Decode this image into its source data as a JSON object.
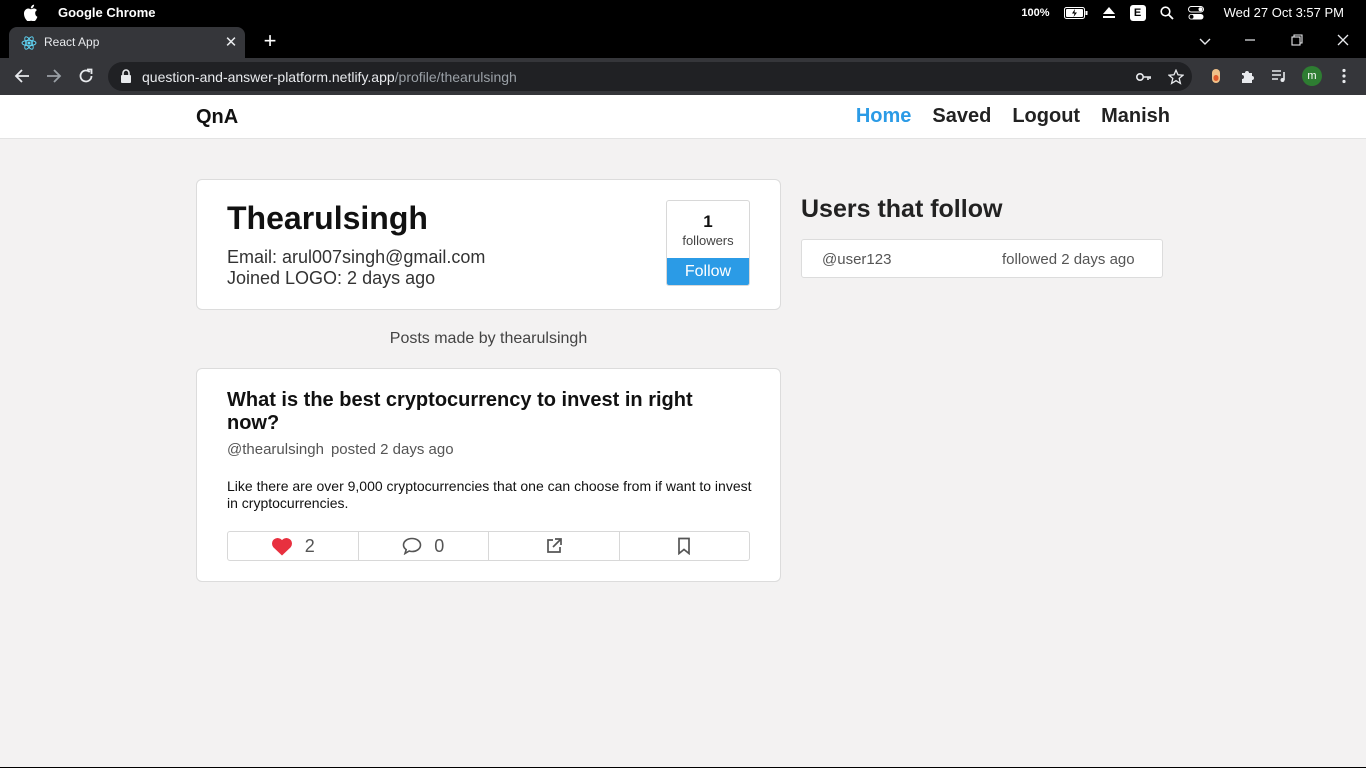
{
  "os_menubar": {
    "app_name": "Google Chrome",
    "battery_percent": "100%",
    "input_badge": "E",
    "clock": "Wed 27 Oct  3:57 PM"
  },
  "browser": {
    "tab_title": "React App",
    "url_host": "question-and-answer-platform.netlify.app",
    "url_path": "/profile/thearulsingh",
    "profile_initial": "m"
  },
  "navbar": {
    "brand": "QnA",
    "links": [
      "Home",
      "Saved",
      "Logout",
      "Manish"
    ],
    "active_link": "Home"
  },
  "profile": {
    "name": "Thearulsingh",
    "email_line": "Email: arul007singh@gmail.com",
    "joined_line": "Joined LOGO: 2 days ago",
    "followers_count": "1",
    "followers_label": "followers",
    "follow_button": "Follow"
  },
  "posts_heading": "Posts made by thearulsingh",
  "post": {
    "title": "What is the best cryptocurrency to invest in right now?",
    "author": "@thearulsingh",
    "posted": "posted 2 days ago",
    "body": "Like there are over 9,000 cryptocurrencies that one can choose from if want to invest in cryptocurrencies.",
    "likes": "2",
    "comments": "0"
  },
  "followers_section": {
    "heading": "Users that follow",
    "items": [
      {
        "user": "@user123",
        "time": "followed 2 days ago"
      }
    ]
  },
  "colors": {
    "accent": "#2b9be6",
    "like": "#e8303f",
    "page_bg": "#f3f2f2"
  }
}
